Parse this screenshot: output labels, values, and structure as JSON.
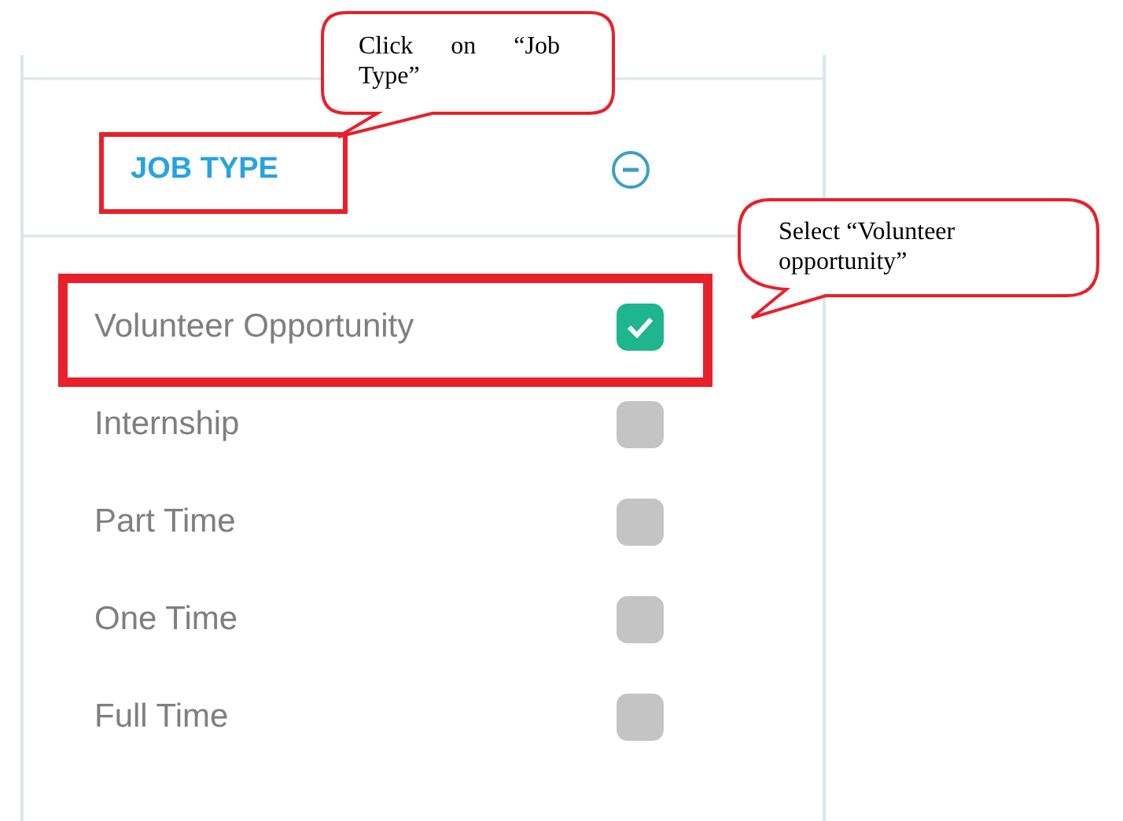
{
  "filter": {
    "title": "JOB TYPE",
    "expanded": true
  },
  "options": [
    {
      "label": "Volunteer Opportunity",
      "checked": true
    },
    {
      "label": "Internship",
      "checked": false
    },
    {
      "label": "Part Time",
      "checked": false
    },
    {
      "label": "One Time",
      "checked": false
    },
    {
      "label": "Full Time",
      "checked": false
    }
  ],
  "annotations": [
    {
      "text": "Click on “Job Type”",
      "kind": "header"
    },
    {
      "text": "Select “Volunteer opportunity”",
      "kind": "option"
    }
  ]
}
